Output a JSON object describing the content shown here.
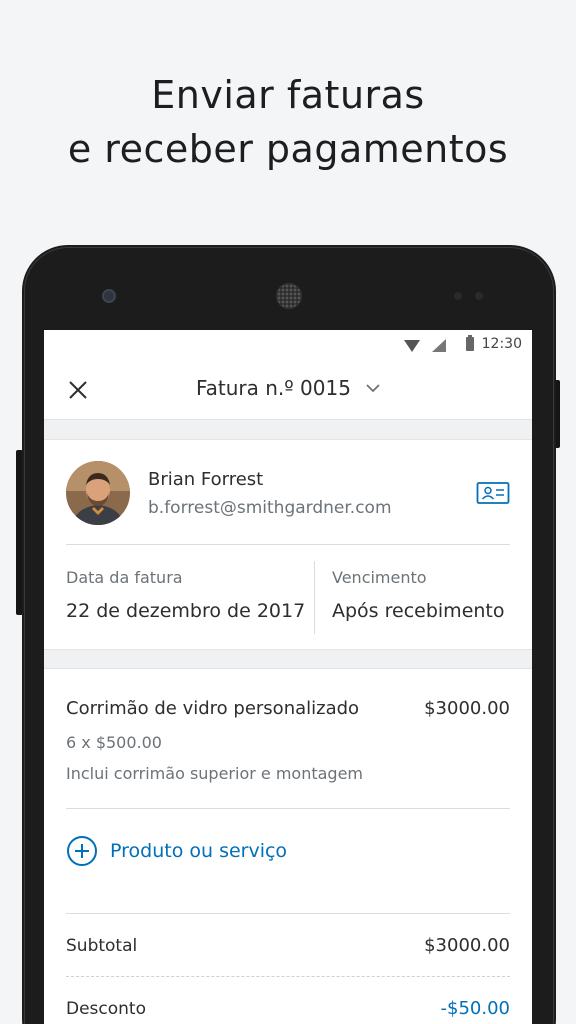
{
  "headline": {
    "line1": "Enviar faturas",
    "line2": "e receber pagamentos"
  },
  "status_bar": {
    "time": "12:30"
  },
  "app_bar": {
    "title": "Fatura n.º 0015",
    "close_icon": "close-icon",
    "dropdown_icon": "chevron-down-icon"
  },
  "customer": {
    "name": "Brian Forrest",
    "email": "b.forrest@smithgardner.com"
  },
  "dates": {
    "invoice_date_label": "Data da fatura",
    "invoice_date_value": "22 de dezembro de 2017",
    "due_label": "Vencimento",
    "due_value": "Após recebimento"
  },
  "line_item": {
    "name": "Corrimão de vidro personalizado",
    "price": "$3000.00",
    "quantity": "6 x $500.00",
    "description": "Inclui corrimão superior e montagem"
  },
  "add_item": {
    "label": "Produto ou serviço"
  },
  "summary": {
    "subtotal_label": "Subtotal",
    "subtotal_value": "$3000.00",
    "discount_label": "Desconto",
    "discount_value": "-$50.00"
  },
  "colors": {
    "accent": "#0070ba",
    "text_primary": "#2c2e2f",
    "text_secondary": "#6c7378"
  }
}
